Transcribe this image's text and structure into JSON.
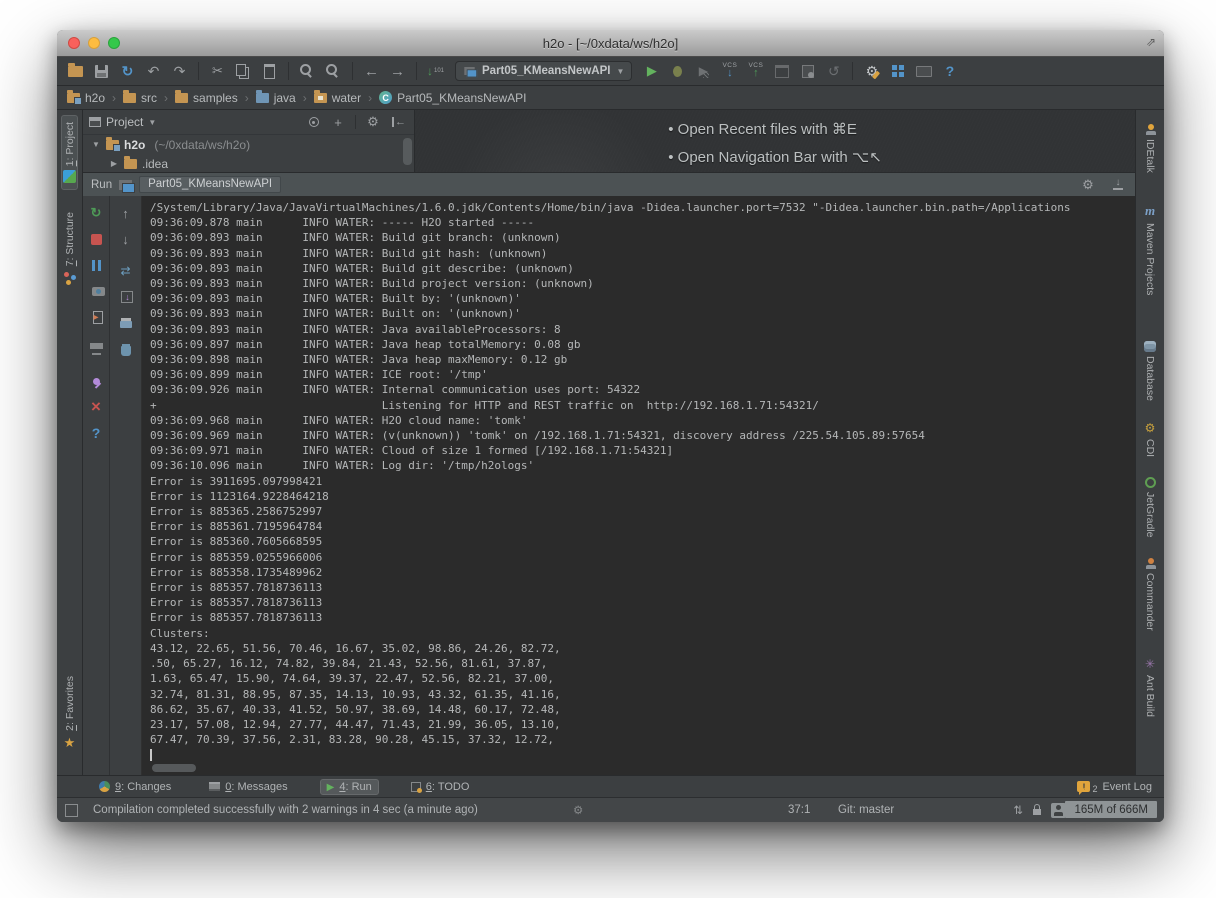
{
  "window": {
    "title": "h2o - [~/0xdata/ws/h2o]"
  },
  "toolbar": {
    "run_config": "Part05_KMeansNewAPI",
    "vcs_label": "VCS",
    "icons": [
      "open",
      "save",
      "sync",
      "undo",
      "redo",
      "cut",
      "copy",
      "paste",
      "find",
      "find-in-path",
      "back",
      "forward",
      "compile",
      "run",
      "debug",
      "run-with-coverage",
      "vcs-update",
      "vcs-commit",
      "archive",
      "diff",
      "rollback",
      "settings",
      "project-structure",
      "export-keymap",
      "help"
    ]
  },
  "breadcrumbs": [
    {
      "label": "h2o",
      "icon": "project-folder-icon"
    },
    {
      "label": "src",
      "icon": "folder-icon"
    },
    {
      "label": "samples",
      "icon": "folder-icon"
    },
    {
      "label": "java",
      "icon": "java-folder-icon"
    },
    {
      "label": "water",
      "icon": "package-folder-icon"
    },
    {
      "label": "Part05_KMeansNewAPI",
      "icon": "class-icon"
    }
  ],
  "left_stripe": [
    {
      "mnemonic": "1",
      "text": ": Project",
      "icon": "project-tool-icon"
    },
    {
      "mnemonic": "7",
      "text": ": Structure",
      "icon": "structure-tool-icon"
    },
    {
      "mnemonic": "2",
      "text": ": Favorites",
      "icon": "favorites-star-icon"
    }
  ],
  "right_stripe": [
    "IDEtalk",
    "Maven Projects",
    "Database",
    "CDI",
    "JetGradle",
    "Commander",
    "Ant Build"
  ],
  "project_panel": {
    "header": "Project",
    "root_name": "h2o",
    "root_path": "(~/0xdata/ws/h2o)",
    "child": ".idea"
  },
  "editor": {
    "tips": [
      "• Open Recent files with ⌘E",
      "• Open Navigation Bar with ⌥↖"
    ]
  },
  "run_panel": {
    "run_label": "Run",
    "tab": "Part05_KMeansNewAPI",
    "action_icons": [
      "rerun",
      "stop",
      "pause",
      "dump-threads",
      "exit",
      "console-settings",
      "pin",
      "close",
      "help"
    ],
    "gutter_icons": [
      "up-stack-trace",
      "down-stack-trace",
      "soft-wrap",
      "scroll-to-end",
      "print",
      "clear-all"
    ],
    "console_lines": [
      "/System/Library/Java/JavaVirtualMachines/1.6.0.jdk/Contents/Home/bin/java -Didea.launcher.port=7532 \"-Didea.launcher.bin.path=/Applications",
      "09:36:09.878 main      INFO WATER: ----- H2O started -----",
      "09:36:09.893 main      INFO WATER: Build git branch: (unknown)",
      "09:36:09.893 main      INFO WATER: Build git hash: (unknown)",
      "09:36:09.893 main      INFO WATER: Build git describe: (unknown)",
      "09:36:09.893 main      INFO WATER: Build project version: (unknown)",
      "09:36:09.893 main      INFO WATER: Built by: '(unknown)'",
      "09:36:09.893 main      INFO WATER: Built on: '(unknown)'",
      "09:36:09.893 main      INFO WATER: Java availableProcessors: 8",
      "09:36:09.897 main      INFO WATER: Java heap totalMemory: 0.08 gb",
      "09:36:09.898 main      INFO WATER: Java heap maxMemory: 0.12 gb",
      "09:36:09.899 main      INFO WATER: ICE root: '/tmp'",
      "09:36:09.926 main      INFO WATER: Internal communication uses port: 54322",
      "+                                  Listening for HTTP and REST traffic on  http://192.168.1.71:54321/",
      "09:36:09.968 main      INFO WATER: H2O cloud name: 'tomk'",
      "09:36:09.969 main      INFO WATER: (v(unknown)) 'tomk' on /192.168.1.71:54321, discovery address /225.54.105.89:57654",
      "09:36:09.971 main      INFO WATER: Cloud of size 1 formed [/192.168.1.71:54321]",
      "09:36:10.096 main      INFO WATER: Log dir: '/tmp/h2ologs'",
      "Error is 3911695.097998421",
      "Error is 1123164.9228464218",
      "Error is 885365.2586752997",
      "Error is 885361.7195964784",
      "Error is 885360.7605668595",
      "Error is 885359.0255966006",
      "Error is 885358.1735489962",
      "Error is 885357.7818736113",
      "Error is 885357.7818736113",
      "Error is 885357.7818736113",
      "Clusters:",
      "43.12, 22.65, 51.56, 70.46, 16.67, 35.02, 98.86, 24.26, 82.72,",
      ".50, 65.27, 16.12, 74.82, 39.84, 21.43, 52.56, 81.61, 37.87,",
      "1.63, 65.47, 15.90, 74.64, 39.37, 22.47, 52.56, 82.21, 37.00,",
      "32.74, 81.31, 88.95, 87.35, 14.13, 10.93, 43.32, 61.35, 41.16,",
      "86.62, 35.67, 40.33, 41.52, 50.97, 38.69, 14.48, 60.17, 72.48,",
      "23.17, 57.08, 12.94, 27.77, 44.47, 71.43, 21.99, 36.05, 13.10,",
      "67.47, 70.39, 37.56, 2.31, 83.28, 90.28, 45.15, 37.32, 12.72,"
    ]
  },
  "bottom_bar": {
    "tabs": [
      {
        "mnemonic": "9",
        "text": ": Changes",
        "icon": "changes-icon"
      },
      {
        "mnemonic": "0",
        "text": ": Messages",
        "icon": "messages-icon"
      },
      {
        "mnemonic": "4",
        "text": ": Run",
        "icon": "run-icon"
      },
      {
        "mnemonic": "6",
        "text": ": TODO",
        "icon": "todo-icon"
      }
    ],
    "event_log": {
      "count": "2",
      "label": "Event Log"
    }
  },
  "status_bar": {
    "message": "Compilation completed successfully with 2 warnings in 4 sec (a minute ago)",
    "position": "37:1",
    "git": "Git: master",
    "memory": "165M of 666M"
  },
  "colors": {
    "panel_bg": "#3c3f41",
    "console_bg": "#2b2b2b",
    "run_green": "#63b25e",
    "stop_red": "#c75450",
    "accent_blue": "#5394c9",
    "folder_tan": "#c49552"
  }
}
